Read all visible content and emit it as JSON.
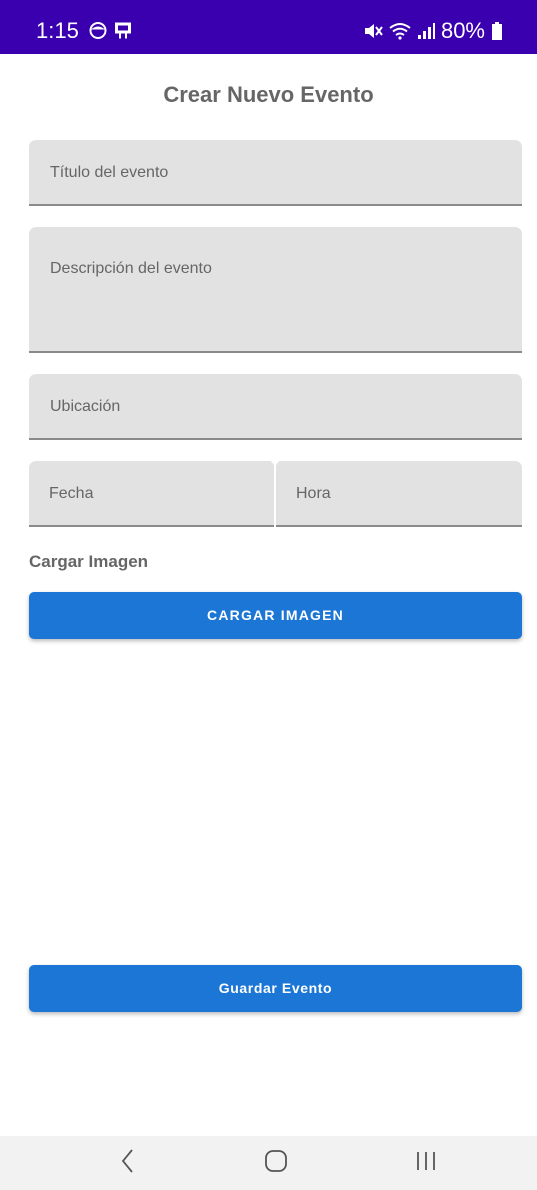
{
  "status_bar": {
    "time": "1:15",
    "battery": "80%",
    "background": "#3a00b0",
    "left_icons": [
      "face-notification-icon",
      "device-notification-icon"
    ],
    "right_icons": [
      "mute-icon",
      "wifi-icon",
      "signal-icon",
      "battery-icon"
    ]
  },
  "page": {
    "title": "Crear Nuevo Evento"
  },
  "form": {
    "title_placeholder": "Título del evento",
    "description_placeholder": "Descripción del evento",
    "location_placeholder": "Ubicación",
    "date_placeholder": "Fecha",
    "time_placeholder": "Hora",
    "image_section_label": "Cargar Imagen",
    "upload_button": "CARGAR IMAGEN",
    "save_button": "Guardar Evento"
  },
  "colors": {
    "accent": "#1b76d6",
    "field_background": "#e2e2e2"
  },
  "nav_bar": {
    "icons": [
      "back-icon",
      "home-icon",
      "recent-apps-icon"
    ]
  }
}
